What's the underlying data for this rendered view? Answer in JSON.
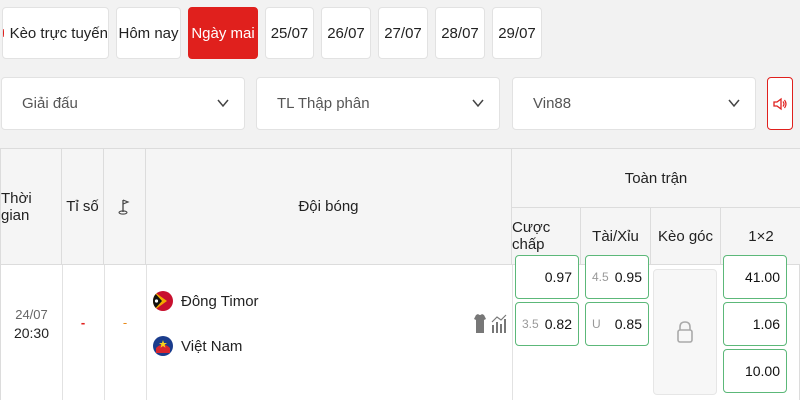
{
  "tabs": {
    "live": "Kèo trực tuyến",
    "today": "Hôm nay",
    "tomorrow": "Ngày mai",
    "d1": "25/07",
    "d2": "26/07",
    "d3": "27/07",
    "d4": "28/07",
    "d5": "29/07"
  },
  "filters": {
    "league": "Giải đấu",
    "odds_format": "TL Thập phân",
    "bookmaker": "Vin88"
  },
  "table": {
    "headers": {
      "time": "Thời gian",
      "score": "Tỉ số",
      "teams": "Đội bóng",
      "full_match": "Toàn trận",
      "handicap": "Cược chấp",
      "over_under": "Tài/Xỉu",
      "corner": "Kèo góc",
      "one_x_two": "1×2"
    },
    "match": {
      "date": "24/07",
      "time": "20:30",
      "score": "-",
      "corner_score": "-",
      "home": "Đông Timor",
      "away": "Việt Nam",
      "handicap": {
        "home_value": "0.97",
        "away_line": "3.5",
        "away_value": "0.82"
      },
      "over_under": {
        "over_line": "4.5",
        "over_value": "0.95",
        "under_line": "U",
        "under_value": "0.85"
      },
      "one_x_two": {
        "home": "41.00",
        "away": "1.06",
        "draw": "10.00"
      }
    }
  },
  "colors": {
    "accent": "#e0201d",
    "odds_border": "#5cb879"
  }
}
